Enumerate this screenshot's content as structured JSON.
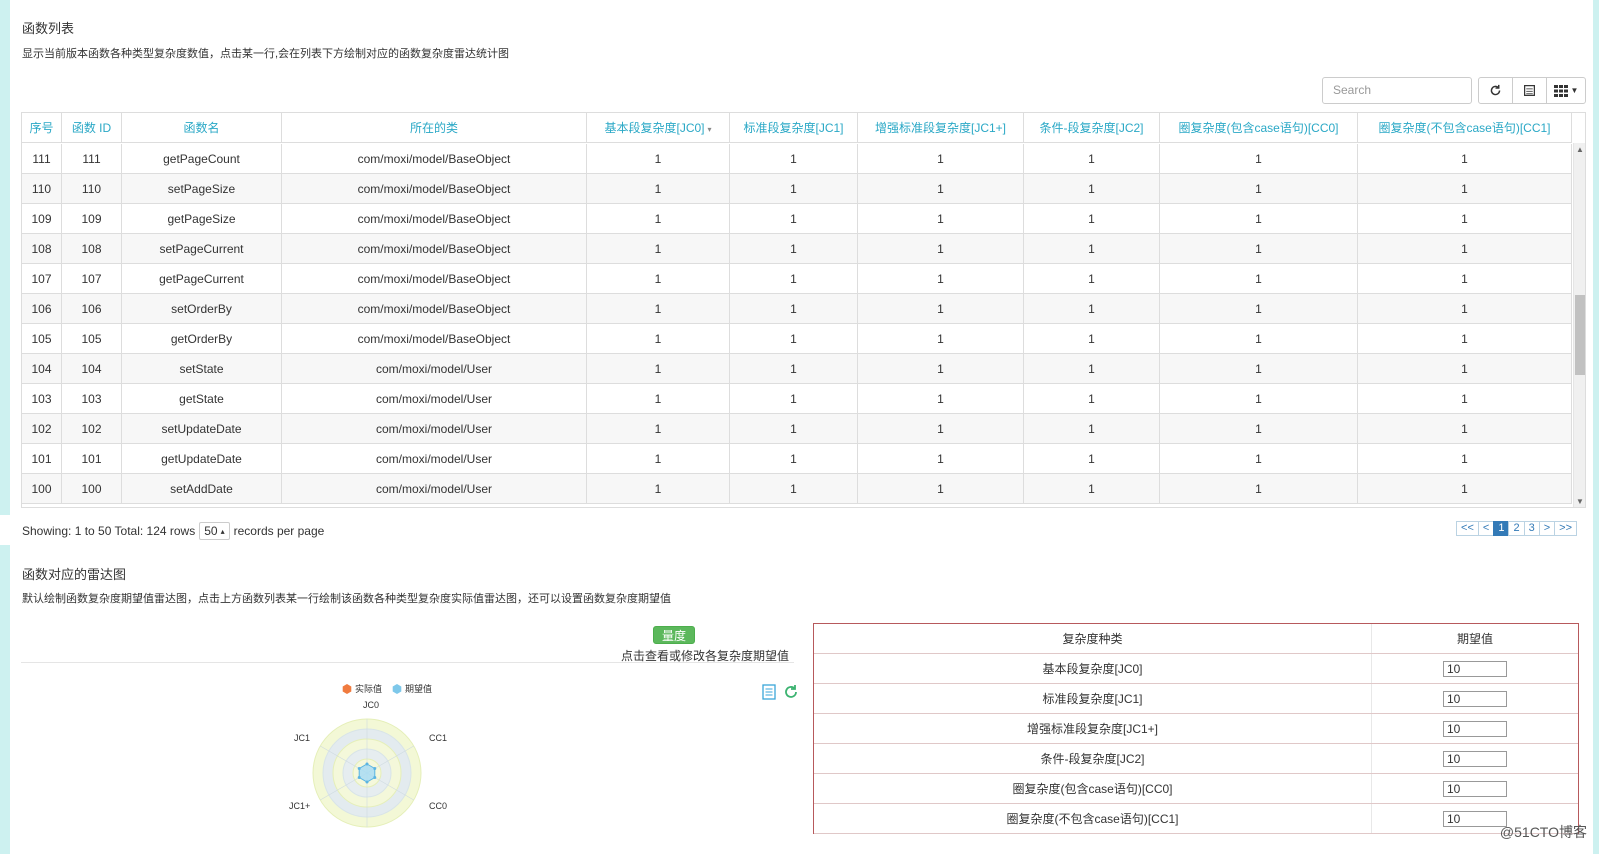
{
  "list": {
    "title": "函数列表",
    "description": "显示当前版本函数各种类型复杂度数值，点击某一行,会在列表下方绘制对应的函数复杂度雷达统计图",
    "search_placeholder": "Search",
    "columns": [
      "序号",
      "函数 ID",
      "函数名",
      "所在的类",
      "基本段复杂度[JC0]",
      "标准段复杂度[JC1]",
      "增强标准段复杂度[JC1+]",
      "条件-段复杂度[JC2]",
      "圈复杂度(包含case语句)[CC0]",
      "圈复杂度(不包含case语句)[CC1]"
    ],
    "sort_caret": "▾",
    "rows": [
      [
        "111",
        "111",
        "getPageCount",
        "com/moxi/model/BaseObject",
        "1",
        "1",
        "1",
        "1",
        "1",
        "1"
      ],
      [
        "110",
        "110",
        "setPageSize",
        "com/moxi/model/BaseObject",
        "1",
        "1",
        "1",
        "1",
        "1",
        "1"
      ],
      [
        "109",
        "109",
        "getPageSize",
        "com/moxi/model/BaseObject",
        "1",
        "1",
        "1",
        "1",
        "1",
        "1"
      ],
      [
        "108",
        "108",
        "setPageCurrent",
        "com/moxi/model/BaseObject",
        "1",
        "1",
        "1",
        "1",
        "1",
        "1"
      ],
      [
        "107",
        "107",
        "getPageCurrent",
        "com/moxi/model/BaseObject",
        "1",
        "1",
        "1",
        "1",
        "1",
        "1"
      ],
      [
        "106",
        "106",
        "setOrderBy",
        "com/moxi/model/BaseObject",
        "1",
        "1",
        "1",
        "1",
        "1",
        "1"
      ],
      [
        "105",
        "105",
        "getOrderBy",
        "com/moxi/model/BaseObject",
        "1",
        "1",
        "1",
        "1",
        "1",
        "1"
      ],
      [
        "104",
        "104",
        "setState",
        "com/moxi/model/User",
        "1",
        "1",
        "1",
        "1",
        "1",
        "1"
      ],
      [
        "103",
        "103",
        "getState",
        "com/moxi/model/User",
        "1",
        "1",
        "1",
        "1",
        "1",
        "1"
      ],
      [
        "102",
        "102",
        "setUpdateDate",
        "com/moxi/model/User",
        "1",
        "1",
        "1",
        "1",
        "1",
        "1"
      ],
      [
        "101",
        "101",
        "getUpdateDate",
        "com/moxi/model/User",
        "1",
        "1",
        "1",
        "1",
        "1",
        "1"
      ],
      [
        "100",
        "100",
        "setAddDate",
        "com/moxi/model/User",
        "1",
        "1",
        "1",
        "1",
        "1",
        "1"
      ]
    ],
    "footer": {
      "showing_text": "Showing: 1 to 50 Total: 124 rows",
      "page_size": "50",
      "page_size_caret": "▴",
      "records_text": "records per page"
    },
    "pagination": [
      "<<",
      "<",
      "1",
      "2",
      "3",
      ">",
      ">>"
    ],
    "active_page": "1"
  },
  "radar": {
    "title": "函数对应的雷达图",
    "description": "默认绘制函数复杂度期望值雷达图，点击上方函数列表某一行绘制该函数各种类型复杂度实际值雷达图，还可以设置函数复杂度期望值",
    "measure_button": "量度",
    "measure_hint": "点击查看或修改各复杂度期望值",
    "legend": [
      {
        "name": "实际值",
        "color": "#f07b3f"
      },
      {
        "name": "期望值",
        "color": "#7ec8ea"
      }
    ],
    "axes": [
      "JC0",
      "CC1",
      "CC0",
      "JC1+",
      "JC1"
    ],
    "expected_values": [
      10,
      10,
      10,
      10,
      10,
      10
    ]
  },
  "expectations": {
    "header_type": "复杂度种类",
    "header_value": "期望值",
    "rows": [
      {
        "name": "基本段复杂度[JC0]",
        "value": "10"
      },
      {
        "name": "标准段复杂度[JC1]",
        "value": "10"
      },
      {
        "name": "增强标准段复杂度[JC1+]",
        "value": "10"
      },
      {
        "name": "条件-段复杂度[JC2]",
        "value": "10"
      },
      {
        "name": "圈复杂度(包含case语句)[CC0]",
        "value": "10"
      },
      {
        "name": "圈复杂度(不包含case语句)[CC1]",
        "value": "10"
      }
    ]
  },
  "watermark": "@51CTO博客",
  "colors": {
    "header_text": "#2aa8c6",
    "accent": "#337ab7",
    "green": "#5cb85c",
    "frame": "#b7595c"
  }
}
